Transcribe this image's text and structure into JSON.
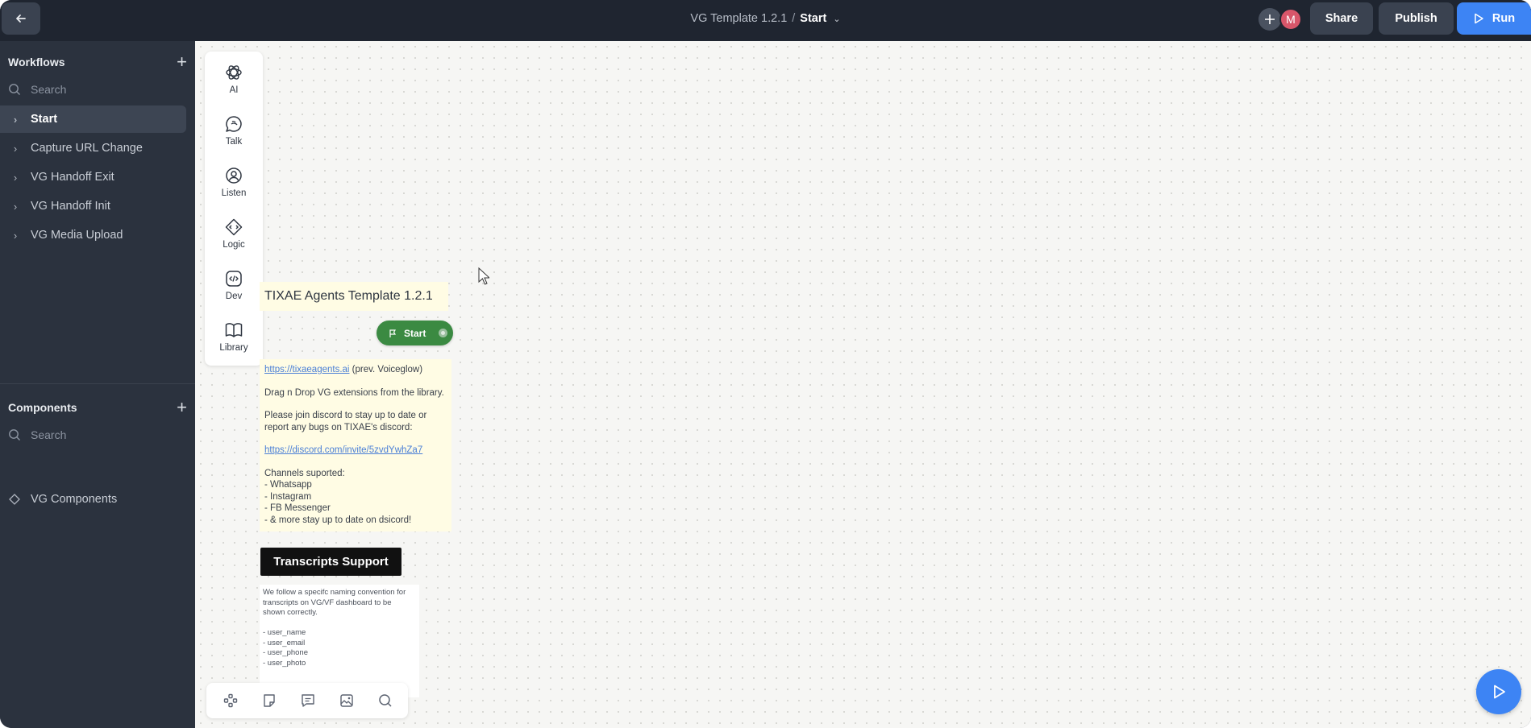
{
  "topbar": {
    "project": "VG Template 1.2.1",
    "separator": "/",
    "current_flow": "Start",
    "avatar_initial": "M",
    "share_label": "Share",
    "publish_label": "Publish",
    "run_label": "Run",
    "accent_color": "#3d84f4"
  },
  "sidebar": {
    "workflows_title": "Workflows",
    "workflows_search_placeholder": "Search",
    "workflows": [
      {
        "label": "Start"
      },
      {
        "label": "Capture URL Change"
      },
      {
        "label": "VG Handoff Exit"
      },
      {
        "label": "VG Handoff Init"
      },
      {
        "label": "VG Media Upload"
      }
    ],
    "components_title": "Components",
    "components_search_placeholder": "Search",
    "components": [
      {
        "label": "VG Components"
      }
    ]
  },
  "toolbox": [
    {
      "label": "AI",
      "icon": "openai-icon"
    },
    {
      "label": "Talk",
      "icon": "chat-bubble-icon"
    },
    {
      "label": "Listen",
      "icon": "user-circle-icon"
    },
    {
      "label": "Logic",
      "icon": "diamond-logic-icon"
    },
    {
      "label": "Dev",
      "icon": "code-icon"
    },
    {
      "label": "Library",
      "icon": "book-icon"
    }
  ],
  "canvas": {
    "note_title": "TIXAE Agents Template 1.2.1",
    "start_block_label": "Start",
    "start_block_color": "#3b8a42",
    "note_link": "https://tixaeagents.ai",
    "note_link_suffix": " (prev. Voiceglow)",
    "note_line2": "Drag n Drop VG extensions from the library.",
    "note_line3": "Please join discord to stay up to date or\nreport any bugs on TIXAE's discord:",
    "note_discord_link": "https://discord.com/invite/5zvdYwhZa7",
    "note_channels": "Channels suported:\n- Whatsapp\n- Instagram\n- FB Messenger\n- & more stay up to date on dsicord!",
    "transcripts_label": "Transcripts Support",
    "transcripts_note": "We follow a specifc naming convention for\ntranscripts on VG/VF dashboard to be\nshown correctly.\n\n- user_name\n- user_email\n- user_phone\n- user_photo"
  }
}
